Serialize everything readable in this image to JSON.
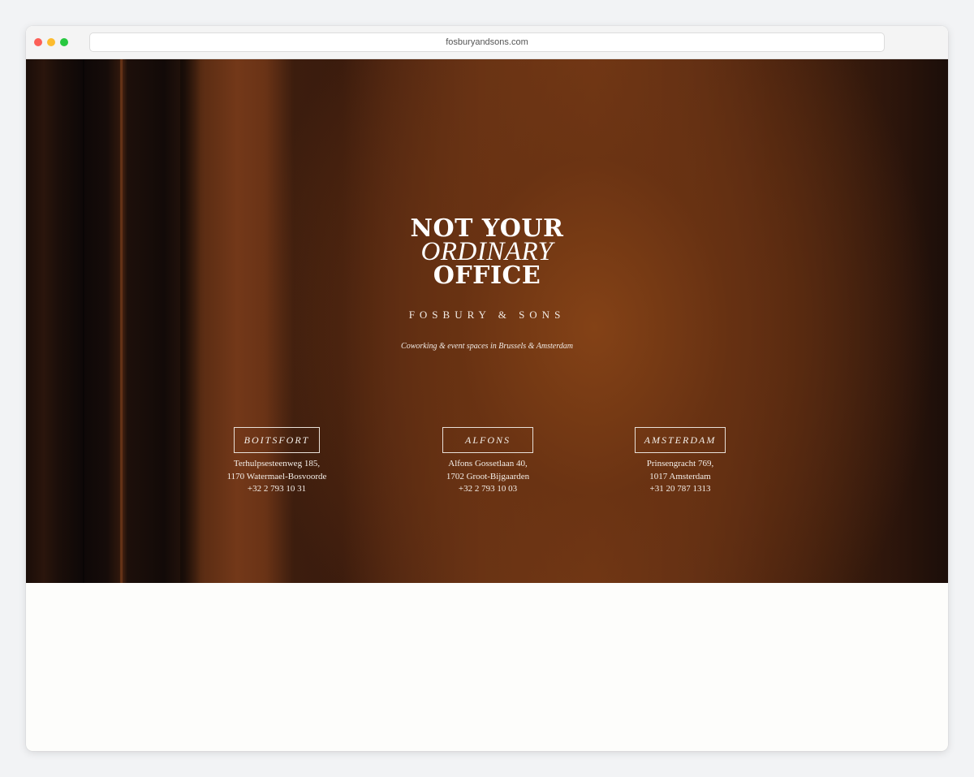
{
  "browser": {
    "url": "fosburyandsons.com"
  },
  "hero": {
    "title_line1": "NOT YOUR",
    "title_line2": "ORDINARY",
    "title_line3": "OFFICE",
    "brand": "FOSBURY & SONS",
    "tagline": "Coworking & event spaces in Brussels & Amsterdam"
  },
  "locations": [
    {
      "name": "BOITSFORT",
      "address_line1": "Terhulpsesteenweg 185,",
      "address_line2": "1170 Watermael-Bosvoorde",
      "phone": "+32 2 793 10 31"
    },
    {
      "name": "ALFONS",
      "address_line1": "Alfons Gossetlaan 40,",
      "address_line2": "1702 Groot-Bijgaarden",
      "phone": "+32 2 793 10 03"
    },
    {
      "name": "AMSTERDAM",
      "address_line1": "Prinsengracht 769,",
      "address_line2": "1017 Amsterdam",
      "phone": "+31 20 787 1313"
    }
  ],
  "colors": {
    "hero_accent": "#7a3c18",
    "text_light": "#f4efe9",
    "page_bg": "#fdfdfb"
  }
}
